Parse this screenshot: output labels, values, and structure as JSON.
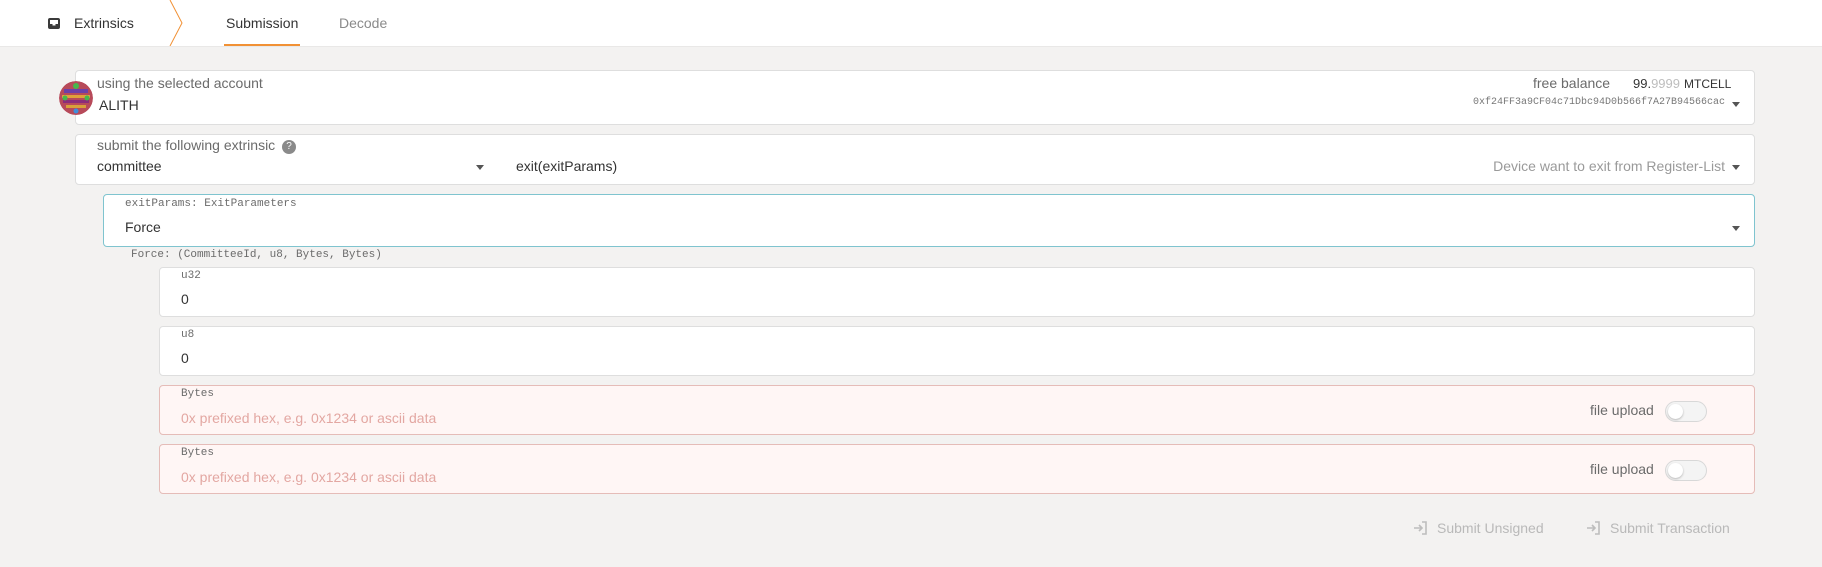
{
  "nav": {
    "app_title": "Extrinsics",
    "app_icon": "inbox-icon",
    "tabs": [
      {
        "label": "Submission",
        "active": true
      },
      {
        "label": "Decode",
        "active": false
      }
    ]
  },
  "account": {
    "label": "using the selected account",
    "name": "ALITH",
    "balance_label": "free balance",
    "balance_int": "99.",
    "balance_frac": "9999",
    "balance_unit": "MTCELL",
    "address": "0xf24FF3a9CF04c71Dbc94D0b566f7A27B94566cac"
  },
  "extrinsic": {
    "label": "submit the following extrinsic",
    "help_icon": "?",
    "section": "committee",
    "method": "exit(exitParams)",
    "description": "Device want to exit from Register-List"
  },
  "params": {
    "exit_label": "exitParams: ExitParameters",
    "exit_value": "Force",
    "force_signature": "Force: (CommitteeId, u8, Bytes, Bytes)",
    "fields": [
      {
        "label": "u32",
        "value": "0"
      },
      {
        "label": "u8",
        "value": "0"
      },
      {
        "label": "Bytes",
        "placeholder": "0x prefixed hex, e.g. 0x1234 or ascii data",
        "upload_label": "file upload",
        "upload_on": false
      },
      {
        "label": "Bytes",
        "placeholder": "0x prefixed hex, e.g. 0x1234 or ascii data",
        "upload_label": "file upload",
        "upload_on": false
      }
    ]
  },
  "actions": {
    "submit_unsigned": "Submit Unsigned",
    "submit_transaction": "Submit Transaction"
  },
  "colors": {
    "accent": "#f19135",
    "error_bg": "#fff6f5",
    "error_border": "#e5bcb8",
    "placeholder": "#e3a7a2",
    "selected_border": "#7fc4cf"
  }
}
